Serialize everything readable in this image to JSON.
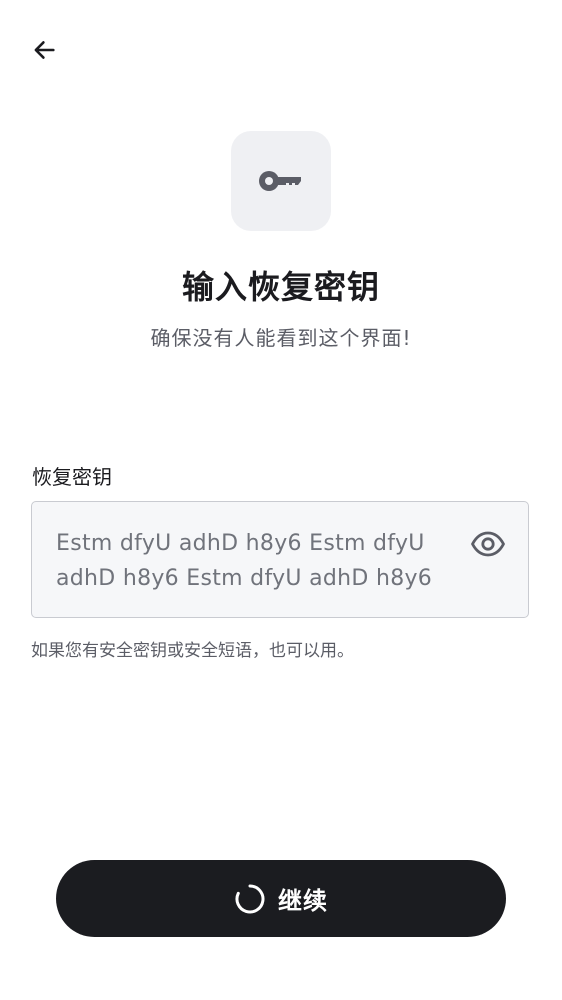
{
  "header": {
    "back_icon": "arrow-left-icon"
  },
  "hero": {
    "icon": "key-icon",
    "title": "输入恢复密钥",
    "subtitle": "确保没有人能看到这个界面!"
  },
  "form": {
    "label": "恢复密钥",
    "value_line1": "Estm dfyU adhD h8y6 Estm dfyU",
    "value_line2": "adhD h8y6 Estm dfyU adhD h8y6",
    "toggle_icon": "eye-icon",
    "helper": "如果您有安全密钥或安全短语，也可以用。"
  },
  "actions": {
    "continue_label": "继续",
    "loading_icon": "spinner-icon"
  },
  "colors": {
    "primary": "#1b1c20",
    "tile_bg": "#eff0f3",
    "field_bg": "#f6f7f9",
    "muted_text": "#5b5d66"
  }
}
